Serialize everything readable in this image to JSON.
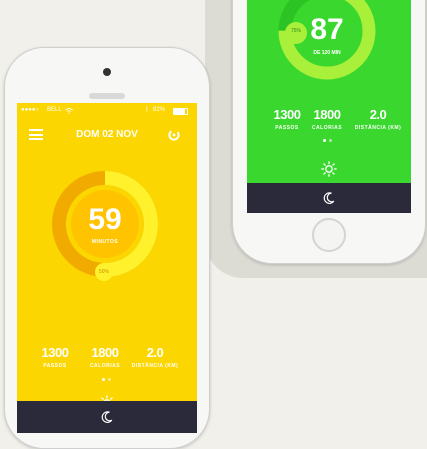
{
  "colors": {
    "green": "#3ad82e",
    "yellow": "#fcd600",
    "dark": "#2b2a3b",
    "background": "#f1f0ea"
  },
  "back_screen": {
    "minutes": "87",
    "goal_label": "DE 120 MIN",
    "percent": "75%",
    "progress": 0.75,
    "stats": [
      {
        "value": "1300",
        "label": "PASSOS"
      },
      {
        "value": "1800",
        "label": "CALORIAS"
      },
      {
        "value": "2.0",
        "label": "DISTÂNCIA (KM)"
      }
    ],
    "icons": {
      "sun": "sun-icon",
      "moon": "moon-icon"
    }
  },
  "front_screen": {
    "status": {
      "carrier": "BELL",
      "battery": "82%"
    },
    "header": {
      "date": "DOM 02 NOV"
    },
    "minutes": "59",
    "minutes_label": "MINUTOS",
    "percent": "50%",
    "progress": 0.5,
    "stats": [
      {
        "value": "1300",
        "label": "PASSOS"
      },
      {
        "value": "1800",
        "label": "CALORIAS"
      },
      {
        "value": "2.0",
        "label": "DISTÂNCIA (KM)"
      }
    ],
    "icons": {
      "menu": "hamburger-menu-icon",
      "refresh": "refresh-icon",
      "sun": "sun-icon",
      "moon": "moon-icon",
      "wifi": "wifi-icon",
      "bluetooth": "bluetooth-icon",
      "battery": "battery-icon"
    }
  }
}
